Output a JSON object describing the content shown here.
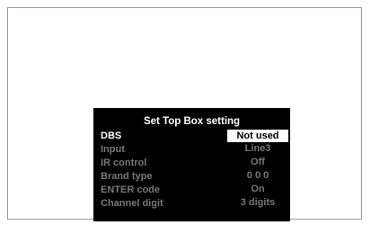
{
  "menu": {
    "title": "Set Top Box setting",
    "items": [
      {
        "label": "DBS",
        "value": "Not used"
      },
      {
        "label": "Input",
        "value": "Line3"
      },
      {
        "label": "IR control",
        "value": "Off"
      },
      {
        "label": "Brand type",
        "value": "0 0 0"
      },
      {
        "label": "ENTER code",
        "value": "On"
      },
      {
        "label": "Channel digit",
        "value": "3 digits"
      }
    ]
  },
  "colors": {
    "menu_background": "#000000",
    "active_label": "#ffffff",
    "inactive_text": "#777777",
    "selection_highlight": "#ffffff"
  }
}
